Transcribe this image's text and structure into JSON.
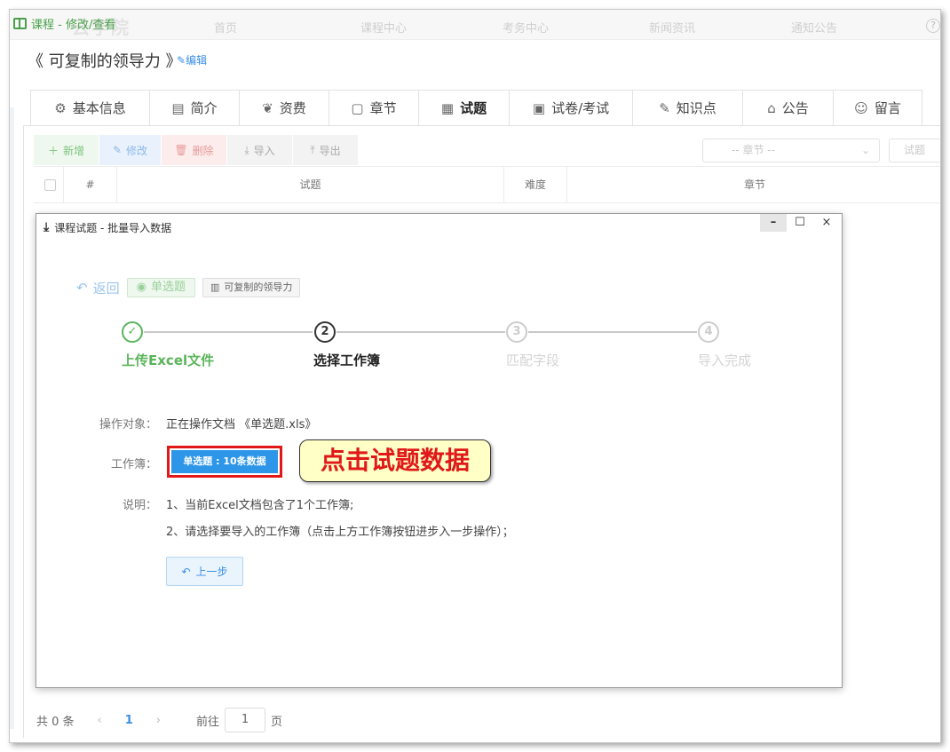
{
  "window": {
    "title": "课程 - 修改/查看",
    "faint_nav": [
      "首页",
      "课程中心",
      "考务中心",
      "新闻资讯",
      "通知公告"
    ],
    "brand": "云学院"
  },
  "course": {
    "title": "《 可复制的领导力 》",
    "edit_label": "编辑"
  },
  "tabs": [
    {
      "label": "基本信息",
      "icon": "gear-icon"
    },
    {
      "label": "简介",
      "icon": "document-icon"
    },
    {
      "label": "资费",
      "icon": "money-bag-icon"
    },
    {
      "label": "章节",
      "icon": "chapter-icon"
    },
    {
      "label": "试题",
      "icon": "question-list-icon",
      "active": true
    },
    {
      "label": "试卷/考试",
      "icon": "exam-paper-icon"
    },
    {
      "label": "知识点",
      "icon": "knowledge-icon"
    },
    {
      "label": "公告",
      "icon": "announce-icon"
    },
    {
      "label": "留言",
      "icon": "message-icon"
    }
  ],
  "toolbar": {
    "add": "新增",
    "modify": "修改",
    "delete": "删除",
    "import": "导入",
    "export": "导出"
  },
  "filters": {
    "chapter_placeholder": "-- 章节 --",
    "question_placeholder": "试题"
  },
  "table": {
    "columns": [
      "#",
      "试题",
      "难度",
      "章节"
    ]
  },
  "pager": {
    "total": "共 0 条",
    "current": "1",
    "goto_label": "前往",
    "goto_value": "1",
    "page_suffix": "页"
  },
  "modal": {
    "title": "课程试题 - 批量导入数据",
    "back": "返回",
    "question_type": "单选题",
    "course_tag": "可复制的领导力",
    "steps": [
      {
        "number": "✓",
        "label": "上传Excel文件",
        "state": "done"
      },
      {
        "number": "2",
        "label": "选择工作簿",
        "state": "current"
      },
      {
        "number": "3",
        "label": "匹配字段",
        "state": "pending"
      },
      {
        "number": "4",
        "label": "导入完成",
        "state": "pending"
      }
    ],
    "target_label": "操作对象：",
    "target_value": "正在操作文档 《单选题.xls》",
    "workbook_label": "工作簿：",
    "workbook_button": "单选题 : 10条数据",
    "note_label": "说明：",
    "note_1": "1、当前Excel文档包含了1个工作簿;",
    "note_2": "2、请选择要导入的工作簿（点击上方工作簿按钮进步入一步操作）；",
    "prev_button": "上一步"
  },
  "annotation": {
    "callout": "点击试题数据",
    "callout_color": "#e01818"
  }
}
